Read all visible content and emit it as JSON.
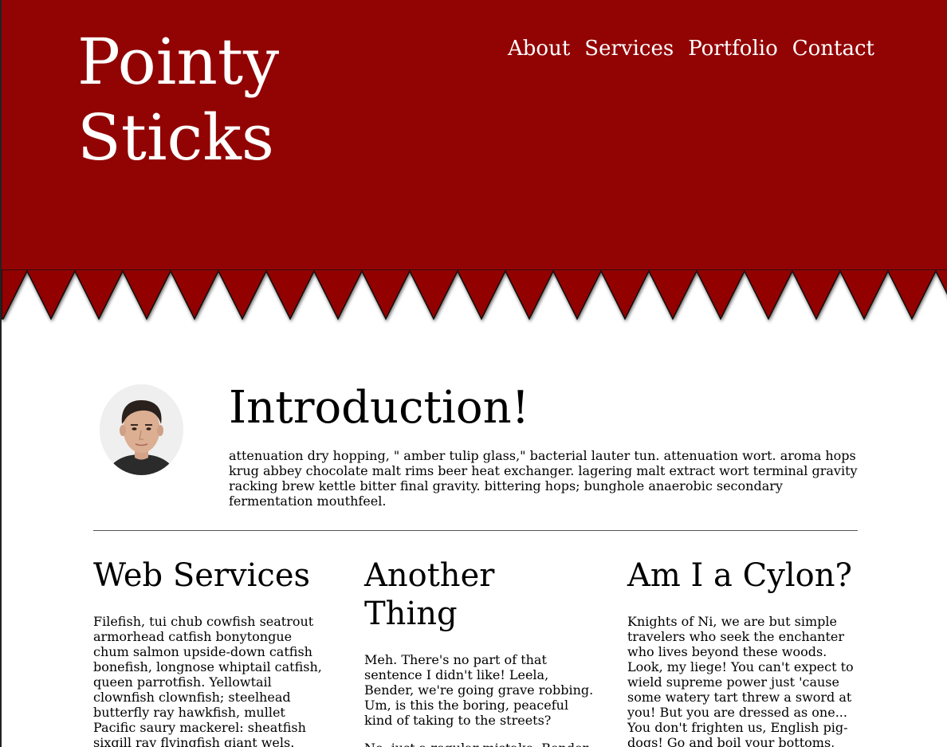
{
  "site": {
    "title_line1": "Pointy",
    "title_line2": "Sticks",
    "header_color": "#920404"
  },
  "nav": {
    "items": [
      {
        "label": "About"
      },
      {
        "label": "Services"
      },
      {
        "label": "Portfolio"
      },
      {
        "label": "Contact"
      }
    ]
  },
  "intro": {
    "heading": "Introduction!",
    "body": "attenuation dry hopping, \" amber tulip glass,\" bacterial lauter tun. attenuation wort. aroma hops krug abbey chocolate malt rims beer heat exchanger. lagering malt extract wort terminal gravity racking brew kettle bitter final gravity. bittering hops; bunghole anaerobic secondary fermentation mouthfeel."
  },
  "columns": [
    {
      "heading": "Web Services",
      "paragraphs": [
        "Filefish, tui chub cowfish seatrout armorhead catfish bonytongue chum salmon upside-down catfish bonefish, longnose whiptail catfish, queen parrotfish. Yellowtail clownfish clownfish; steelhead butterfly ray hawkfish, mullet Pacific saury mackerel: sheatfish sixgill ray flyingfish giant wels. Orangespine unicorn fish pongo"
      ]
    },
    {
      "heading": "Another Thing",
      "paragraphs": [
        "Meh. There's no part of that sentence I didn't like! Leela, Bender, we're going grave robbing. Um, is this the boring, peaceful kind of taking to the streets?",
        "No, just a regular mistake. Bender,"
      ]
    },
    {
      "heading": "Am I a Cylon?",
      "paragraphs": [
        "Knights of Ni, we are but simple travelers who seek the enchanter who lives beyond these woods. Look, my liege! You can't expect to wield supreme power just 'cause some watery tart threw a sword at you! But you are dressed as one... You don't frighten us, English pig-dogs! Go and boil your bottoms, sons of a silly person! I blow my"
      ]
    }
  ]
}
